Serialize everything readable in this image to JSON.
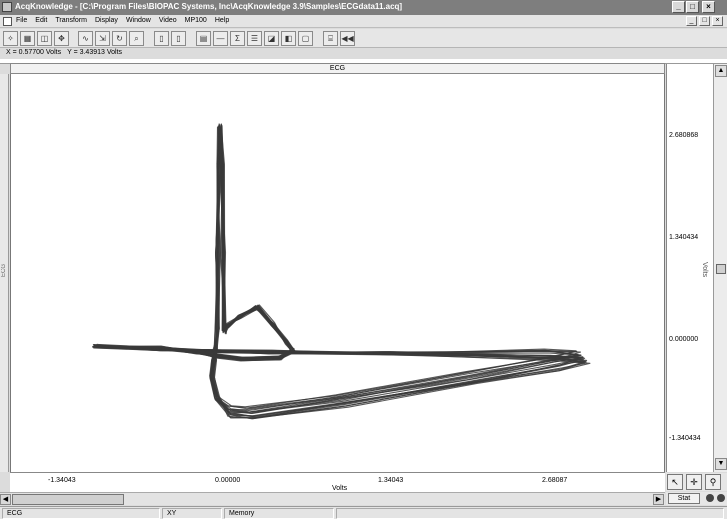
{
  "window": {
    "title": "AcqKnowledge - [C:\\Program Files\\BIOPAC Systems, Inc\\AcqKnowledge 3.9\\Samples\\ECGdata11.acq]",
    "controls": [
      "_",
      "□",
      "×"
    ]
  },
  "menu": {
    "items": [
      "File",
      "Edit",
      "Transform",
      "Display",
      "Window",
      "Video",
      "MP100",
      "Help"
    ],
    "mdi_controls": [
      "_",
      "□",
      "×"
    ]
  },
  "readout": {
    "x": "X = 0.57700 Volts",
    "y": "Y = 3.43913 Volts"
  },
  "channel": {
    "header": "ECG",
    "left_label": "ECG"
  },
  "axes": {
    "y_ticks": [
      "2.680868",
      "1.340434",
      "0.000000",
      "-1.340434"
    ],
    "y_label": "Volts",
    "x_ticks": [
      "-1.34043",
      "0.00000",
      "1.34043",
      "2.68087"
    ],
    "x_label": "Volts"
  },
  "tools": {
    "stat_label": "Stat"
  },
  "status": {
    "channel": "ECG",
    "mode": "XY",
    "storage": "Memory"
  },
  "trace_color": "#3a3a3a"
}
